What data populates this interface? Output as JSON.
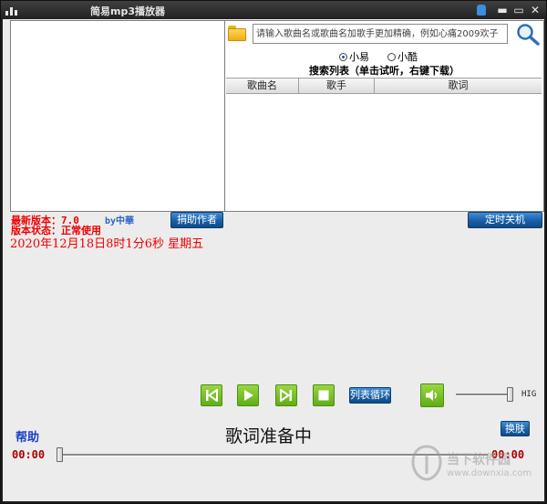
{
  "window": {
    "title": "简易mp3播放器"
  },
  "title_buttons": {
    "minimize": "▬",
    "maximize": "▭",
    "close": "✕"
  },
  "search": {
    "placeholder": "请输入歌曲名或歌曲名加歌手更加精确，例如心痛2009欢子",
    "value": "",
    "sources": [
      {
        "label": "小易",
        "selected": true
      },
      {
        "label": "小酷",
        "selected": false
      }
    ],
    "list_title": "搜索列表（单击试听，右键下载）",
    "columns": [
      "歌曲名",
      "歌手",
      "歌词"
    ]
  },
  "info": {
    "version": "最新版本：7.0",
    "by": "by中華",
    "status": "版本状态：正常使用",
    "datetime": "2020年12月18日8时1分6秒  星期五"
  },
  "buttons": {
    "donate": "捐助作者",
    "shutdown_timer": "定时关机",
    "loop_mode": "列表循环",
    "skin": "换肤",
    "help": "帮助"
  },
  "player": {
    "lyric_status": "歌词准备中",
    "time_current": "00:00",
    "time_total": "00:00",
    "progress": 0,
    "volume": 1.0,
    "volume_label": "HIG"
  },
  "watermark": {
    "text": "当下软件园",
    "url": "www.downxia.com"
  },
  "colors": {
    "accent_green": "#5fae17",
    "accent_blue": "#1a5fa6",
    "red_text": "#e00000",
    "help_blue": "#1a3fc7"
  },
  "icons": [
    "app-icon",
    "skin-icon",
    "folder-icon",
    "search-icon",
    "prev-icon",
    "play-icon",
    "next-icon",
    "stop-icon",
    "volume-icon"
  ]
}
